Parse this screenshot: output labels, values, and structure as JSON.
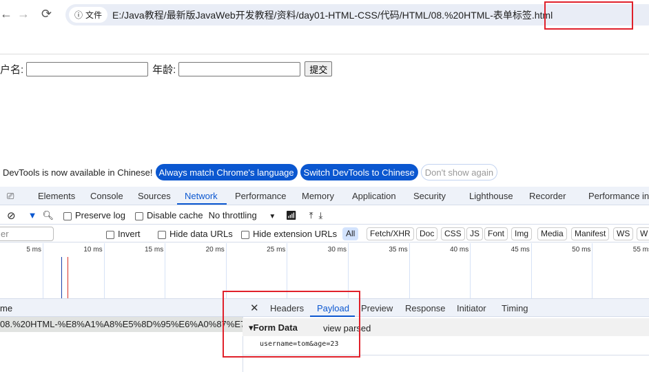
{
  "browser": {
    "back_icon": "←",
    "forward_icon": "→",
    "reload_icon": "⟳",
    "info_icon": "ⓘ",
    "security_chip": "文件",
    "url": "E:/Java教程/最新版JavaWeb开发教程/资料/day01-HTML-CSS/代码/HTML/08.%20HTML-表单标签.html"
  },
  "page": {
    "username_label": "户名:",
    "age_label": "年龄:",
    "submit_label": "提交"
  },
  "banner": {
    "text": "DevTools is now available in Chinese!",
    "always_match": "Always match Chrome's language",
    "switch": "Switch DevTools to Chinese",
    "dont_show": "Don't show again"
  },
  "devtools": {
    "tabs": [
      "Elements",
      "Console",
      "Sources",
      "Network",
      "Performance",
      "Memory",
      "Application",
      "Security",
      "Lighthouse",
      "Recorder",
      "Performance in"
    ],
    "active_tab": "Network",
    "toolbar": {
      "preserve_log": "Preserve log",
      "disable_cache": "Disable cache",
      "throttling": "No throttling"
    },
    "filter": {
      "placeholder_partial": "er",
      "invert": "Invert",
      "hide_data": "Hide data URLs",
      "hide_ext": "Hide extension URLs",
      "types": [
        "All",
        "Fetch/XHR",
        "Doc",
        "CSS",
        "JS",
        "Font",
        "Img",
        "Media",
        "Manifest",
        "WS",
        "W"
      ]
    },
    "timeline_ticks": [
      "5 ms",
      "10 ms",
      "15 ms",
      "20 ms",
      "25 ms",
      "30 ms",
      "35 ms",
      "40 ms",
      "45 ms",
      "50 ms",
      "55 ms"
    ],
    "name_header": "me",
    "request_name": "08.%20HTML-%E8%A1%A8%E5%8D%95%E6%A0%87%E7...",
    "detail_tabs": [
      "Headers",
      "Payload",
      "Preview",
      "Response",
      "Initiator",
      "Timing"
    ],
    "active_detail_tab": "Payload",
    "form_data_label": "Form Data",
    "view_parsed": "view parsed",
    "payload": "username=tom&age=23"
  },
  "colors": {
    "accent": "#0b57d0",
    "highlight": "#e0202a"
  }
}
